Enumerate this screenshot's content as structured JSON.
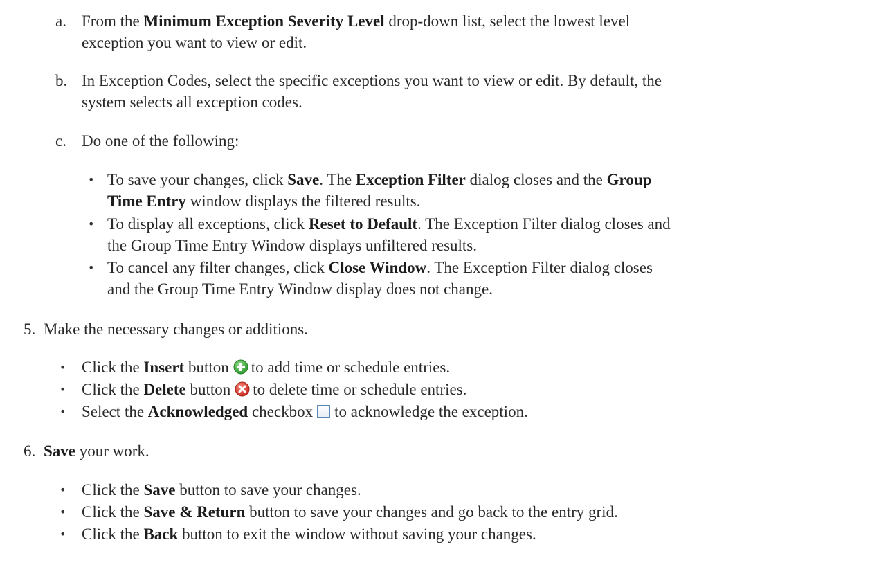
{
  "sub_a": {
    "marker": "a.",
    "p1": "From the ",
    "b1": "Minimum Exception Severity Level",
    "p2": " drop-down list, select the lowest level",
    "line2": "exception you want to view or edit."
  },
  "sub_b": {
    "marker": "b.",
    "line1": "In Exception Codes, select the specific exceptions you want to view or edit. By default, the",
    "line2": "system selects all exception codes."
  },
  "sub_c": {
    "marker": "c.",
    "line1": "Do one of the following:",
    "bullets": [
      {
        "p1": "To save your changes, click ",
        "b1": "Save",
        "p2": ". The ",
        "b2": "Exception Filter",
        "p3": " dialog closes and the ",
        "b3": "Group",
        "l2b": "Time Entry",
        "l2p": " window displays the filtered results."
      },
      {
        "p1": "To display all exceptions, click ",
        "b1": "Reset to Default",
        "p2": ". The Exception Filter dialog closes and",
        "line2": "the Group Time Entry Window displays unfiltered results."
      },
      {
        "p1": "To cancel any filter changes, click ",
        "b1": "Close Window",
        "p2": ".  The Exception Filter dialog closes",
        "line2": "and the Group Time Entry Window display does not change."
      }
    ]
  },
  "step5": {
    "marker": "5.",
    "text": "Make the necessary changes or additions.",
    "bullets": [
      {
        "p1": "Click the ",
        "b1": "Insert",
        "p2": " button",
        "icon": "insert-icon",
        "p3": "to add time or schedule entries."
      },
      {
        "p1": "Click the ",
        "b1": "Delete",
        "p2": " button",
        "icon": "delete-icon",
        "p3": "to delete time or schedule entries."
      },
      {
        "p1": "Select the ",
        "b1": "Acknowledged",
        "p2": " checkbox",
        "icon": "checkbox-icon",
        "p3": "to acknowledge the exception."
      }
    ]
  },
  "step6": {
    "marker": "6.",
    "b": "Save",
    "text": " your work.",
    "bullets": [
      {
        "p1": "Click the ",
        "b1": "Save",
        "p2": " button to save your changes."
      },
      {
        "p1": "Click the ",
        "b1": "Save & Return",
        "p2": " button to save your changes and go back to the entry grid."
      },
      {
        "p1": "Click the ",
        "b1": "Back",
        "p2": " button to exit the window without saving your changes."
      }
    ]
  },
  "colors": {
    "insert_green": "#3aa53a",
    "delete_red": "#d93226",
    "checkbox_border": "#5b86b5"
  }
}
